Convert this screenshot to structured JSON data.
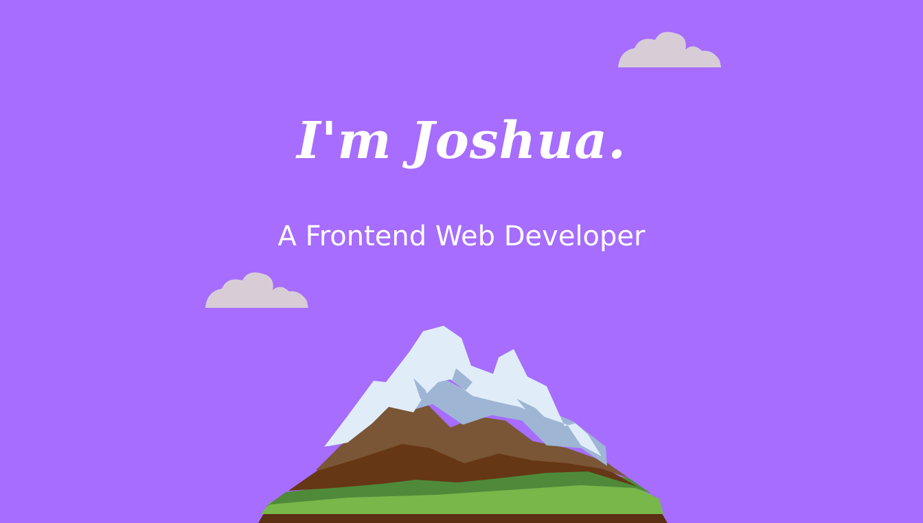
{
  "hero": {
    "title": "I'm Joshua.",
    "subtitle": "A Frontend Web Developer"
  },
  "colors": {
    "background": "#a66dff",
    "text": "#ffffff",
    "cloud": "#d8cdd7",
    "snow": "#e0edf9",
    "snow_shadow": "#9fb5d4",
    "rock_light": "#7a5636",
    "rock_dark": "#663714",
    "grass_dark": "#4e8a3a",
    "grass_light": "#78b84a",
    "soil": "#5a2f12"
  },
  "illustration": {
    "clouds": [
      "cloud",
      "cloud"
    ],
    "mountain": "mountain"
  }
}
